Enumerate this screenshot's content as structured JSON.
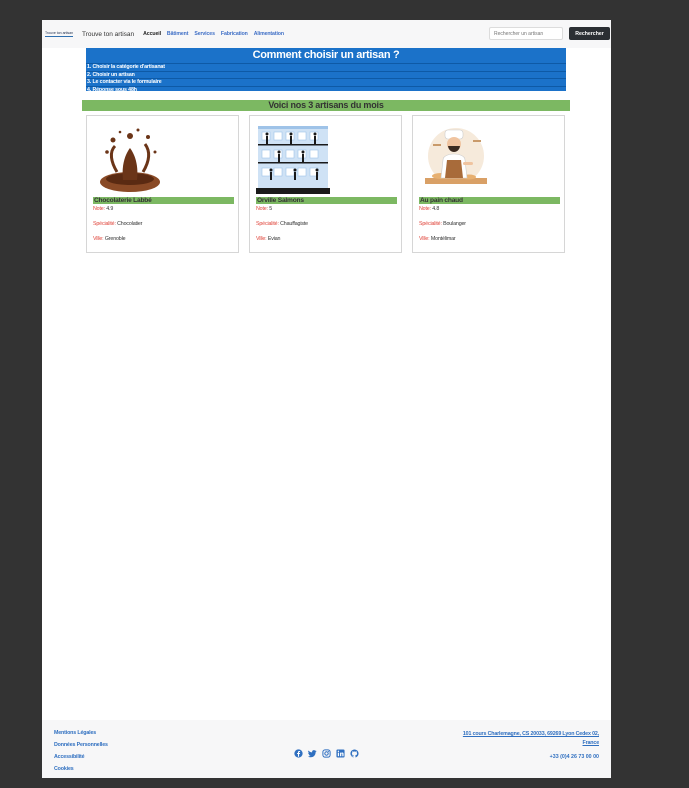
{
  "header": {
    "logo_text": "Trouve ton artisan",
    "brand": "Trouve ton artisan",
    "nav": [
      {
        "label": "Accueil",
        "active": true
      },
      {
        "label": "Bâtiment"
      },
      {
        "label": "Services"
      },
      {
        "label": "Fabrication"
      },
      {
        "label": "Alimentation"
      }
    ],
    "search_placeholder": "Rechercher un artisan",
    "search_button": "Rechercher"
  },
  "guide": {
    "title": "Comment choisir un artisan ?",
    "steps": [
      "1. Choisir la catégorie d'artisanat",
      "2. Choisir un artisan",
      "3. Le contacter via le formulaire",
      "4. Réponse sous 48h"
    ]
  },
  "month": {
    "title": "Voici nos 3 artisans du mois",
    "labels": {
      "note": "Note",
      "specialite": "Spécialité",
      "ville": "Ville"
    },
    "artisans": [
      {
        "name": "Chocolaterie Labbé",
        "note": "4.9",
        "specialite": "Chocolatier",
        "ville": "Grenoble",
        "image": "chocolate-splash-image"
      },
      {
        "name": "Orville Salmons",
        "note": "5",
        "specialite": "Chauffagiste",
        "ville": "Evian",
        "image": "building-workers-image"
      },
      {
        "name": "Au pain chaud",
        "note": "4.8",
        "specialite": "Boulanger",
        "ville": "Montélimar",
        "image": "baker-image"
      }
    ]
  },
  "footer": {
    "links": [
      "Mentions Légales",
      "Données Personnelles",
      "Accessibilité",
      "Cookies"
    ],
    "socials": [
      "facebook-icon",
      "twitter-icon",
      "instagram-icon",
      "linkedin-icon",
      "github-icon"
    ],
    "address_line1": "101 cours Charlemagne, CS 20033, 69269 Lyon Cedex 02,",
    "address_line2": "France",
    "phone": "+33 (0)4 26 73 00 00"
  },
  "colors": {
    "accent_blue": "#1b72c9",
    "accent_green": "#7cb862",
    "label_red": "#e0443a",
    "link_blue": "#2f6fc0"
  }
}
